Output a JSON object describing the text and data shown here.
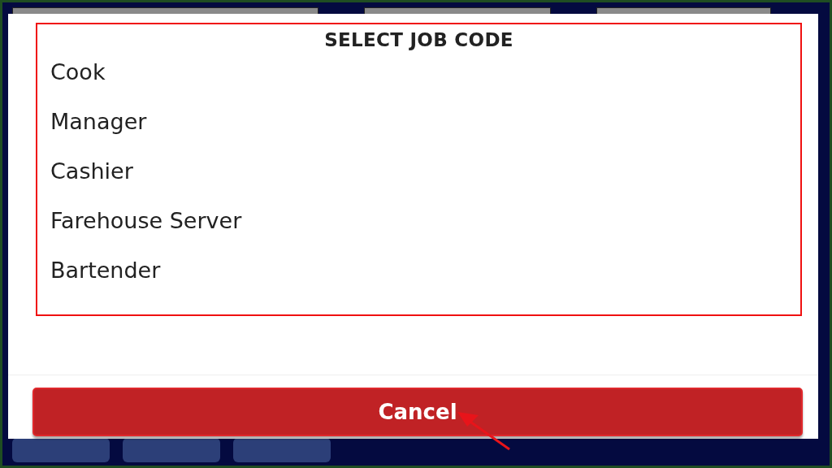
{
  "dialog": {
    "title": "SELECT JOB CODE",
    "items": [
      "Cook",
      "Manager",
      "Cashier",
      "Farehouse Server",
      "Bartender"
    ],
    "cancel_button": "Cancel"
  }
}
